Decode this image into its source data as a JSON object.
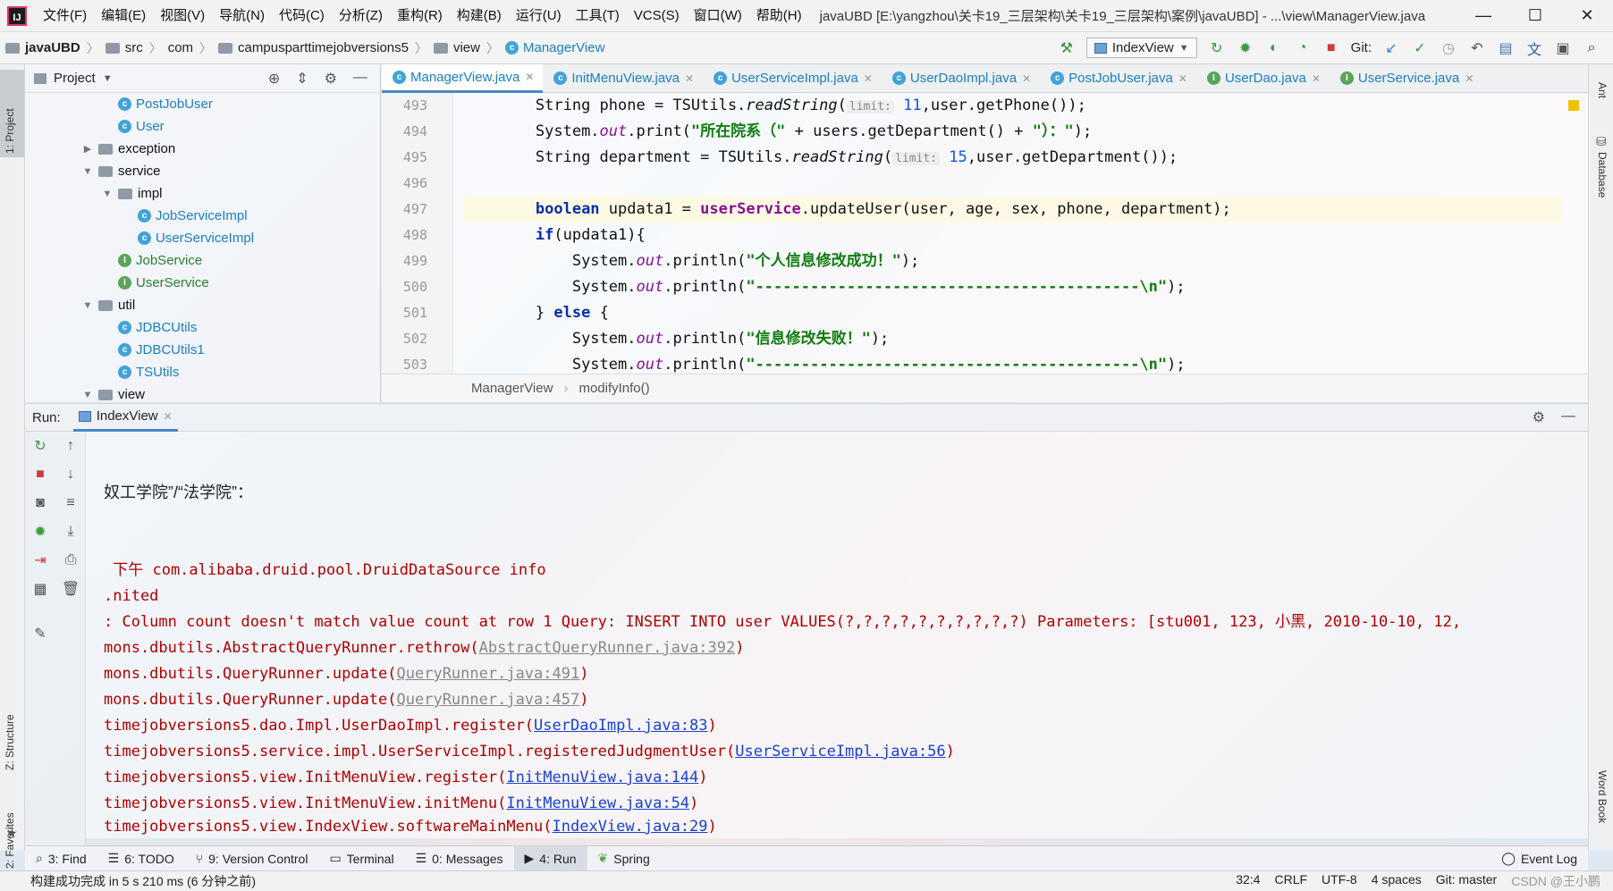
{
  "window": {
    "title": "javaUBD [E:\\yangzhou\\关卡19_三层架构\\关卡19_三层架构\\案例\\javaUBD] - ...\\view\\ManagerView.java"
  },
  "menu": [
    "文件(F)",
    "编辑(E)",
    "视图(V)",
    "导航(N)",
    "代码(C)",
    "分析(Z)",
    "重构(R)",
    "构建(B)",
    "运行(U)",
    "工具(T)",
    "VCS(S)",
    "窗口(W)",
    "帮助(H)"
  ],
  "breadcrumb": [
    "javaUBD",
    "src",
    "com",
    "campusparttimejobversions5",
    "view",
    "ManagerView"
  ],
  "toolbar": {
    "run_config": "IndexView",
    "git_label": "Git:"
  },
  "project": {
    "title": "Project",
    "tree": [
      {
        "label": "PostJobUser",
        "kind": "class",
        "indent": 2
      },
      {
        "label": "User",
        "kind": "class",
        "indent": 2
      },
      {
        "label": "exception",
        "kind": "folder",
        "indent": 1,
        "arrow": "▶"
      },
      {
        "label": "service",
        "kind": "folder",
        "indent": 1,
        "arrow": "▼"
      },
      {
        "label": "impl",
        "kind": "folder",
        "indent": 2,
        "arrow": "▼"
      },
      {
        "label": "JobServiceImpl",
        "kind": "class",
        "indent": 3
      },
      {
        "label": "UserServiceImpl",
        "kind": "class",
        "indent": 3
      },
      {
        "label": "JobService",
        "kind": "interface",
        "indent": 2
      },
      {
        "label": "UserService",
        "kind": "interface",
        "indent": 2
      },
      {
        "label": "util",
        "kind": "folder",
        "indent": 1,
        "arrow": "▼"
      },
      {
        "label": "JDBCUtils",
        "kind": "class",
        "indent": 2
      },
      {
        "label": "JDBCUtils1",
        "kind": "class",
        "indent": 2
      },
      {
        "label": "TSUtils",
        "kind": "class",
        "indent": 2
      },
      {
        "label": "view",
        "kind": "folder",
        "indent": 1,
        "arrow": "▼"
      }
    ]
  },
  "editor": {
    "tabs": [
      {
        "label": "ManagerView.java",
        "kind": "class",
        "active": true
      },
      {
        "label": "InitMenuView.java",
        "kind": "class"
      },
      {
        "label": "UserServiceImpl.java",
        "kind": "class"
      },
      {
        "label": "UserDaoImpl.java",
        "kind": "class"
      },
      {
        "label": "PostJobUser.java",
        "kind": "class"
      },
      {
        "label": "UserDao.java",
        "kind": "interface"
      },
      {
        "label": "UserService.java",
        "kind": "interface"
      }
    ],
    "line_numbers": [
      "493",
      "494",
      "495",
      "496",
      "497",
      "498",
      "499",
      "500",
      "501",
      "502",
      "503"
    ],
    "code": {
      "l493": {
        "a": "String phone = TSUtils.",
        "m": "readString",
        "b": "(",
        "h": "limit:",
        "n": " 11",
        "c": ",user.getPhone());"
      },
      "l494": {
        "a": "System.",
        "f": "out",
        "b": ".print(",
        "s": "\"所在院系（\"",
        "c": " + users.getDepartment() + ",
        "s2": "\"）：\"",
        "d": ");"
      },
      "l495": {
        "a": "String department = TSUtils.",
        "m": "readString",
        "b": "(",
        "h": "limit:",
        "n": " 15",
        "c": ",user.getDepartment());"
      },
      "l497": {
        "k": "boolean",
        "a": " updata1 = ",
        "f": "userService",
        "c": ".updateUser(user, age, sex, phone, department);"
      },
      "l498": {
        "k": "if",
        "c": "(updata1){"
      },
      "l499": {
        "a": "    System.",
        "f": "out",
        "b": ".println(",
        "s": "\"个人信息修改成功！\"",
        "c": ");"
      },
      "l500": {
        "a": "    System.",
        "f": "out",
        "b": ".println(",
        "s": "\"------------------------------------------\\n\"",
        "c": ");"
      },
      "l501": {
        "a": "} ",
        "k": "else",
        "c": " {"
      },
      "l502": {
        "a": "    System.",
        "f": "out",
        "b": ".println(",
        "s": "\"信息修改失败！\"",
        "c": ");"
      },
      "l503": {
        "a": "    System.",
        "f": "out",
        "b": ".println(",
        "s": "\"------------------------------------------\\n\"",
        "c": ");"
      }
    },
    "crumb": [
      "ManagerView",
      "modifyInfo()"
    ]
  },
  "run": {
    "label": "Run:",
    "tab": "IndexView",
    "output": {
      "prompt": "奴工学院”/“法学院”：",
      "e1": " 下午 com.alibaba.druid.pool.DruidDataSource info",
      "e2": ".nited",
      "e3": ": Column count doesn't match value count at row 1 Query: INSERT INTO user VALUES(?,?,?,?,?,?,?,?,?,?) Parameters: [stu001, 123, 小黑, 2010-10-10, 12,",
      "t1a": "mons.dbutils.AbstractQueryRunner.rethrow(",
      "t1b": "AbstractQueryRunner.java:392",
      "t1c": ")",
      "t2a": "mons.dbutils.QueryRunner.update(",
      "t2b": "QueryRunner.java:491",
      "t2c": ")",
      "t3a": "mons.dbutils.QueryRunner.update(",
      "t3b": "QueryRunner.java:457",
      "t3c": ")",
      "t4a": "timejobversions5.dao.Impl.UserDaoImpl.register(",
      "t4b": "UserDaoImpl.java:83",
      "t4c": ")",
      "t5a": "timejobversions5.service.impl.UserServiceImpl.registeredJudgmentUser(",
      "t5b": "UserServiceImpl.java:56",
      "t5c": ")",
      "t6a": "timejobversions5.view.InitMenuView.register(",
      "t6b": "InitMenuView.java:144",
      "t6c": ")",
      "t7a": "timejobversions5.view.InitMenuView.initMenu(",
      "t7b": "InitMenuView.java:54",
      "t7c": ")",
      "t8a": "timejobversions5.view.IndexView.softwareMainMenu(",
      "t8b": "IndexView.java:29",
      "t8c": ")"
    }
  },
  "left_stripe": {
    "project": "1: Project",
    "structure": "Z: Structure",
    "favorites": "2: Favorites"
  },
  "right_stripe": {
    "ant": "Ant",
    "database": "Database",
    "wordbook": "Word Book"
  },
  "bottom_tabs": [
    "3: Find",
    "6: TODO",
    "9: Version Control",
    "Terminal",
    "0: Messages",
    "4: Run",
    "Spring"
  ],
  "event_log": "Event Log",
  "status": {
    "message": "构建成功完成 in 5 s 210 ms (6 分钟之前)",
    "position": "32:4",
    "line_sep": "CRLF",
    "encoding": "UTF-8",
    "indent": "4 spaces",
    "git": "Git: master",
    "watermark": "CSDN @王小鹏"
  }
}
